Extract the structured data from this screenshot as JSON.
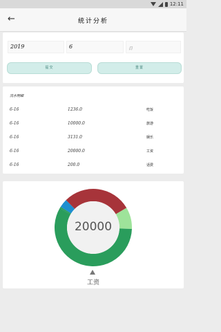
{
  "status": {
    "time": "12:11"
  },
  "appbar": {
    "back_icon": "←",
    "title": "统计分析"
  },
  "form": {
    "year": "2019",
    "month": "6",
    "day_placeholder": "日",
    "submit_label": "提交",
    "reset_label": "重置"
  },
  "detail": {
    "heading": "流水明细",
    "rows": [
      {
        "date": "6-16",
        "amount": "1236.0",
        "category": "吃饭"
      },
      {
        "date": "6-16",
        "amount": "10000.0",
        "category": "旅游"
      },
      {
        "date": "6-16",
        "amount": "3131.0",
        "category": "娱乐"
      },
      {
        "date": "6-16",
        "amount": "20000.0",
        "category": "工资"
      },
      {
        "date": "6-16",
        "amount": "200.0",
        "category": "话费"
      }
    ]
  },
  "chart": {
    "center_value": "20000",
    "pointer_label": "工资"
  },
  "chart_data": {
    "type": "pie",
    "categories": [
      "吃饭",
      "旅游",
      "娱乐",
      "工资",
      "话费"
    ],
    "values": [
      1236.0,
      10000.0,
      3131.0,
      20000.0,
      200.0
    ],
    "colors": [
      "#1e8fd0",
      "#a7343a",
      "#9ee39a",
      "#2a9d5c",
      "#2a9d5c"
    ]
  }
}
